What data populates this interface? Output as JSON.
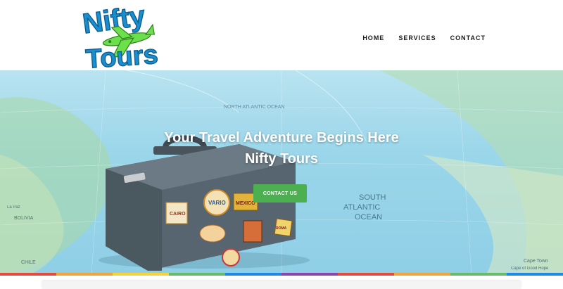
{
  "logo": {
    "line1": "Nifty",
    "line2": "Tours"
  },
  "nav": {
    "items": [
      {
        "label": "HOME"
      },
      {
        "label": "SERVICES"
      },
      {
        "label": "CONTACT"
      }
    ]
  },
  "hero": {
    "title_line1": "Your Travel Adventure Begins Here",
    "title_line2": "Nifty Tours",
    "cta_label": "CONTACT US",
    "map_labels": {
      "north_atlantic": "NORTH ATLANTIC OCEAN",
      "south_atlantic_1": "SOUTH",
      "south_atlantic_2": "ATLANTIC",
      "south_atlantic_3": "OCEAN",
      "cape_town": "Cape Town",
      "good_hope": "Cape of Good Hope",
      "la_paz": "La Paz",
      "bolivia": "BOLIVIA",
      "chile": "CHILE"
    },
    "stickers": [
      "CAIRO",
      "VARIO",
      "MEXICO",
      "ROMA"
    ]
  },
  "colors": {
    "brand_blue": "#1a8fd0",
    "brand_green": "#4caf50",
    "cta_bg": "#4caf50",
    "stripe": [
      "#e64a3b",
      "#f2a33a",
      "#f6d23b",
      "#66bb6a",
      "#1e88e5",
      "#8e44ad",
      "#e64a3b",
      "#f2a33a",
      "#66bb6a",
      "#1e88e5"
    ]
  }
}
